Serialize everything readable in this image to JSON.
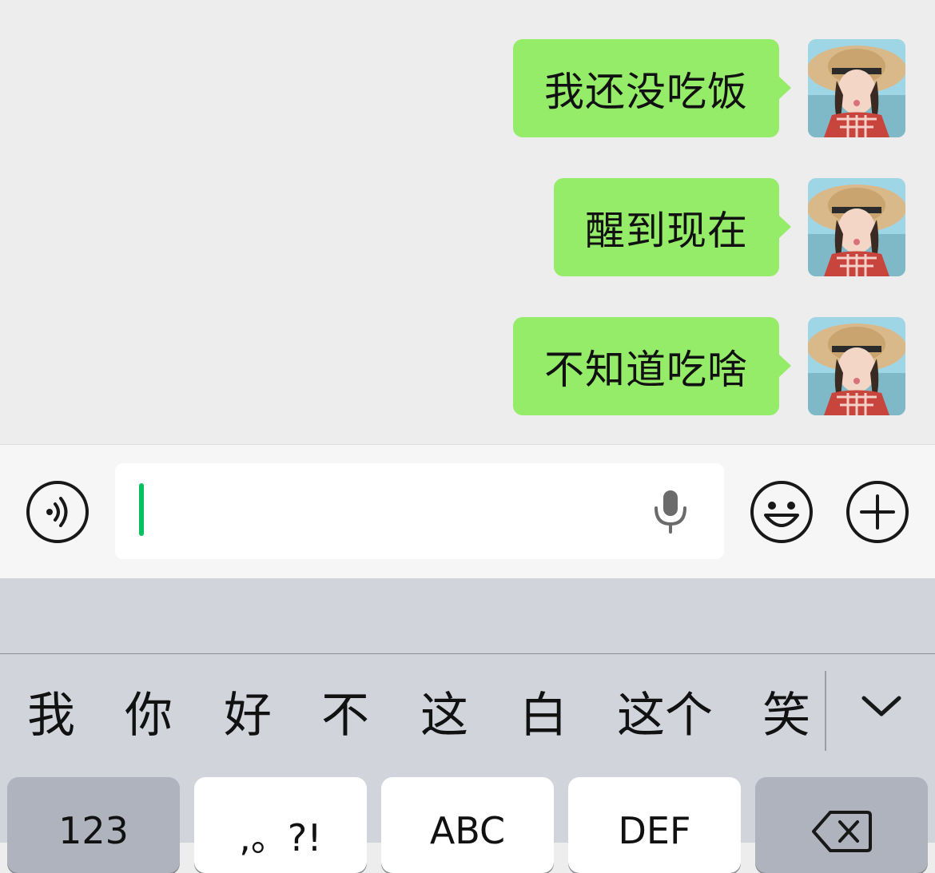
{
  "chat": {
    "messages": [
      {
        "text": "我还没吃饭",
        "sender": "self"
      },
      {
        "text": "醒到现在",
        "sender": "self"
      },
      {
        "text": "不知道吃啥",
        "sender": "self"
      }
    ]
  },
  "input_bar": {
    "voice_icon": "voice-mode-icon",
    "mic_icon": "microphone-icon",
    "emoji_icon": "emoji-icon",
    "plus_icon": "plus-icon",
    "text_value": ""
  },
  "keyboard": {
    "candidates": [
      "我",
      "你",
      "好",
      "不",
      "这",
      "白",
      "这个",
      "笑"
    ],
    "keys": [
      {
        "label": "123"
      },
      {
        "label": ",。?!"
      },
      {
        "label": "ABC"
      },
      {
        "label": "DEF"
      }
    ],
    "delete_icon": "backspace-icon",
    "collapse_icon": "chevron-down-icon"
  },
  "colors": {
    "bubble": "#95ec69",
    "chat_bg": "#ededed",
    "caret": "#07c160",
    "keyboard_bg": "#d1d4db"
  }
}
